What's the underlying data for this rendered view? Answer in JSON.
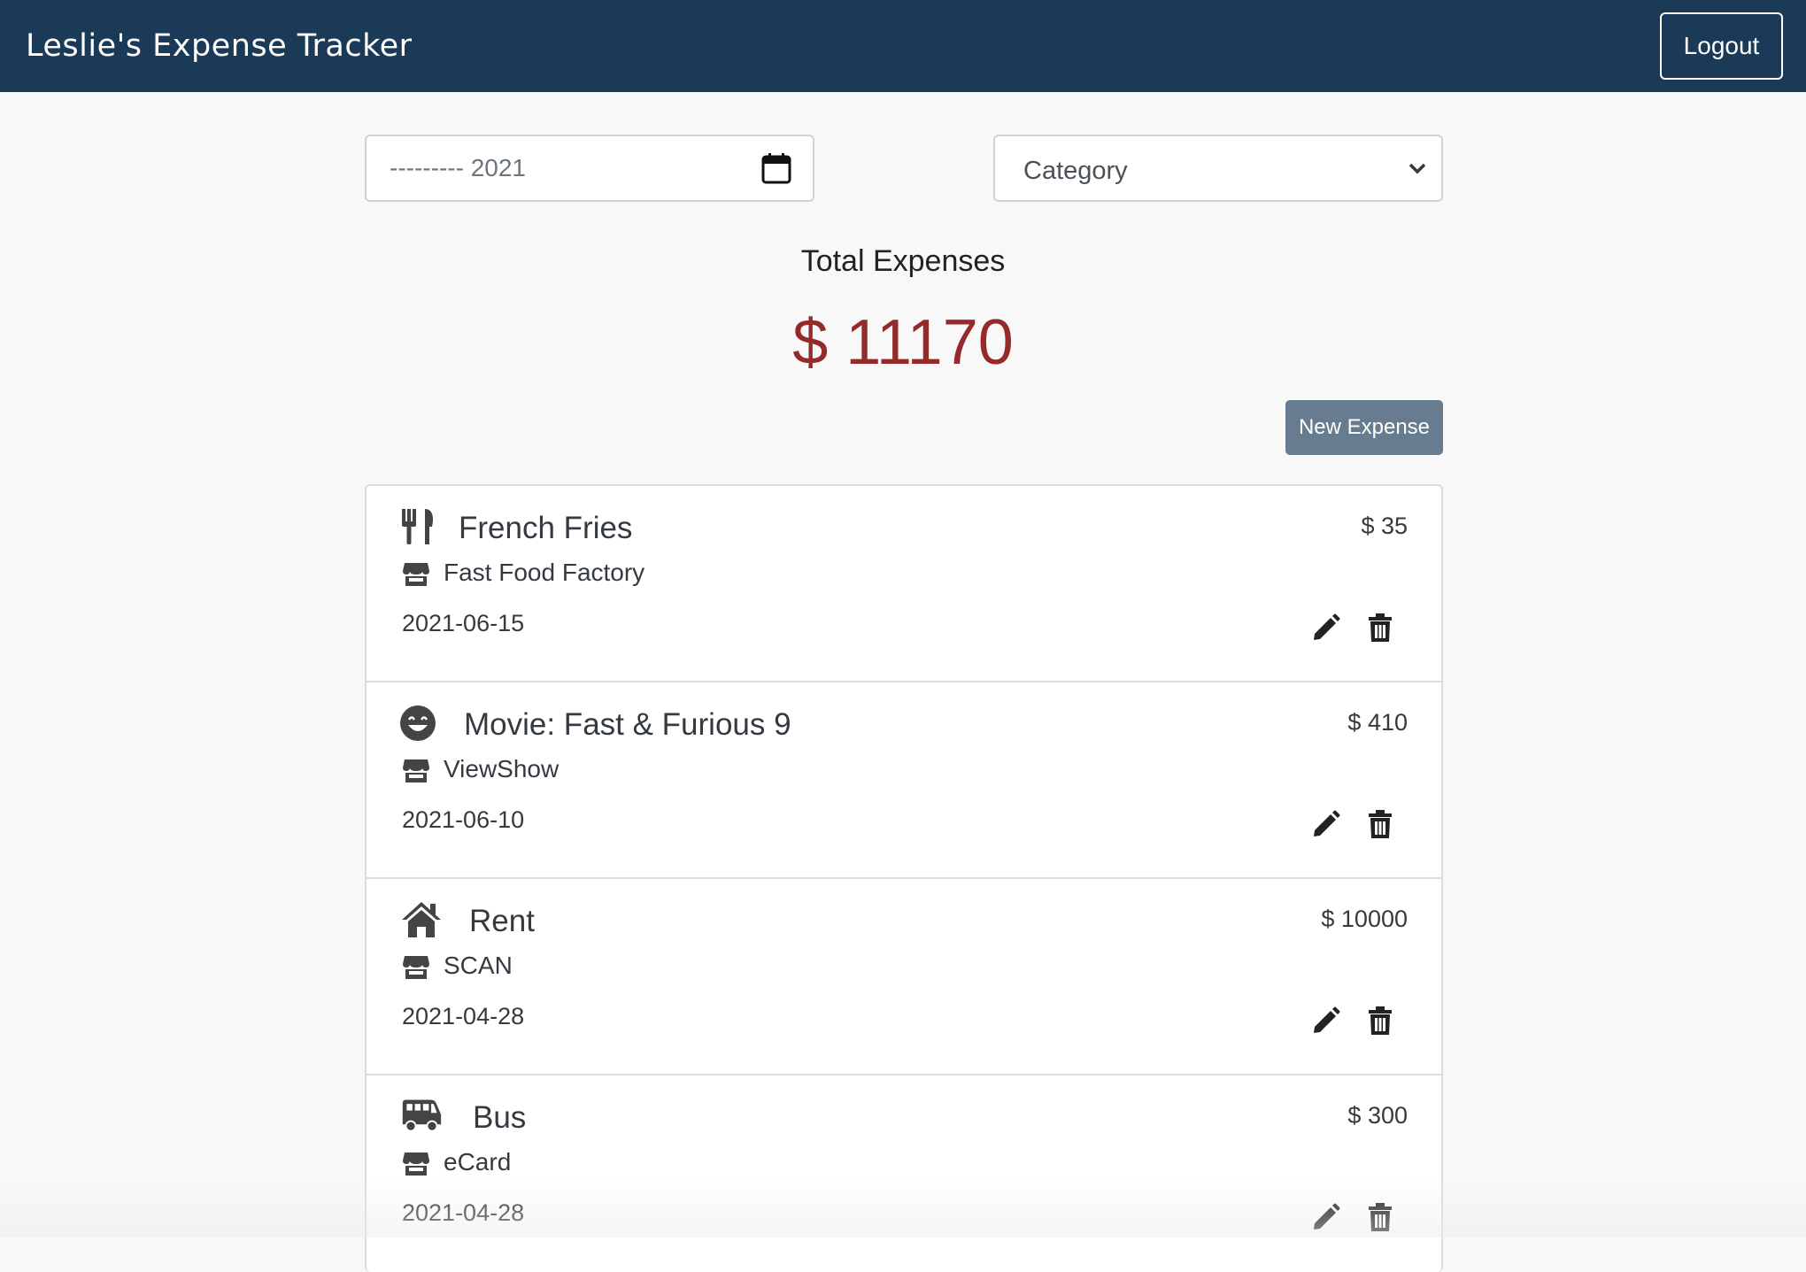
{
  "header": {
    "brand": "Leslie's Expense Tracker",
    "logout_label": "Logout"
  },
  "filters": {
    "month_value": "--------- 2021",
    "category_selected": "Category"
  },
  "summary": {
    "total_label": "Total Expenses",
    "total_amount": "$ 11170"
  },
  "actions": {
    "new_expense_label": "New Expense"
  },
  "expenses": [
    {
      "icon": "utensils-icon",
      "title": "French Fries",
      "vendor": "Fast Food Factory",
      "date": "2021-06-15",
      "amount": "$ 35"
    },
    {
      "icon": "smile-icon",
      "title": "Movie: Fast & Furious 9",
      "vendor": "ViewShow",
      "date": "2021-06-10",
      "amount": "$ 410"
    },
    {
      "icon": "home-icon",
      "title": "Rent",
      "vendor": "SCAN",
      "date": "2021-04-28",
      "amount": "$ 10000"
    },
    {
      "icon": "bus-icon",
      "title": "Bus",
      "vendor": "eCard",
      "date": "2021-04-28",
      "amount": "$ 300"
    }
  ],
  "colors": {
    "navbar": "#1b3a57",
    "total_amount": "#952a2a",
    "new_expense_button": "#677d8f"
  }
}
